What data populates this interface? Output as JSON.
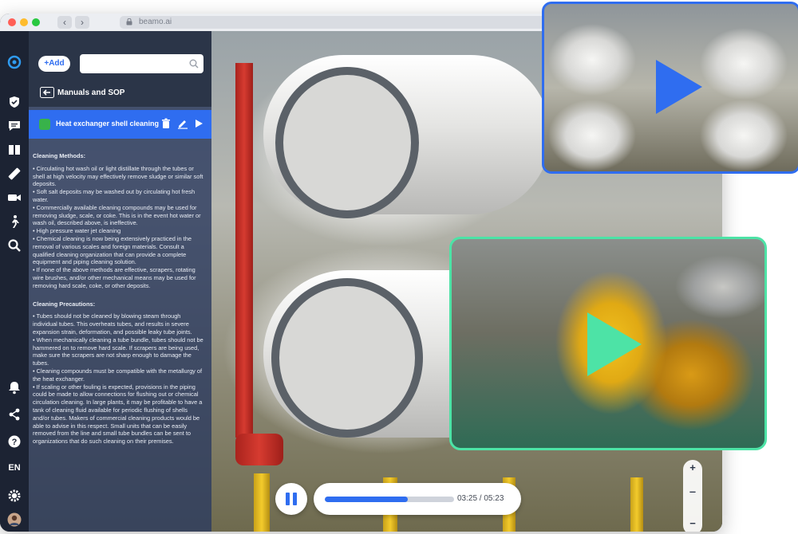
{
  "window": {
    "url": "beamo.ai",
    "traffic_lights": [
      "#ff5f57",
      "#febc2e",
      "#28c840"
    ]
  },
  "rail": {
    "items": [
      {
        "name": "logo-icon"
      },
      {
        "name": "shield-check-icon"
      },
      {
        "name": "chat-icon"
      },
      {
        "name": "manual-book-icon"
      },
      {
        "name": "ruler-icon"
      },
      {
        "name": "video-camera-icon"
      },
      {
        "name": "walking-person-icon"
      },
      {
        "name": "search-icon"
      },
      {
        "name": "bell-icon"
      },
      {
        "name": "share-icon"
      },
      {
        "name": "help-icon"
      },
      {
        "name": "settings-gear-icon"
      },
      {
        "name": "user-avatar"
      }
    ],
    "language": "EN"
  },
  "panel": {
    "add_label": "+Add",
    "search_placeholder": "",
    "back_label": "Manuals and SOP",
    "active_item": "Heat exchanger shell cleaning",
    "sections": [
      {
        "heading": "Cleaning Methods:",
        "paragraphs": [
          "• Circulating hot wash oil or light distillate through the tubes or shell at high velocity may effectively remove sludge or similar soft deposits.",
          "• Soft salt deposits may be washed out by circulating hot fresh water.",
          "• Commercially available cleaning compounds may be used for removing sludge, scale, or coke. This is in the event hot water or wash oil, described above, is ineffective.",
          "• High pressure water jet cleaning",
          "• Chemical cleaning is now being extensively practiced in the removal of various scales and foreign materials. Consult a qualified cleaning organization that can provide a complete equipment and piping cleaning solution.",
          "• If none of the above methods are effective, scrapers, rotating wire brushes, and/or other mechanical means may be used for removing hard scale, coke, or other deposits."
        ]
      },
      {
        "heading": "Cleaning Precautions:",
        "paragraphs": [
          "• Tubes should not be cleaned by blowing steam through individual tubes. This overheats tubes, and results in severe expansion strain, deformation, and possible leaky tube joints.",
          "• When mechanically cleaning a tube bundle, tubes should not be hammered on to remove hard scale. If scrapers are being used, make sure the scrapers are not sharp enough to damage the tubes.",
          "• Cleaning compounds must be compatible with the metallurgy of the heat exchanger.",
          "• If scaling or other fouling is expected, provisions in the piping could be made to allow connections for flushing out or chemical circulation cleaning. In large plants, it may be profitable to have a tank of cleaning fluid available for periodic flushing of shells and/or tubes. Makers of commercial cleaning products would be able to advise in this respect. Small units that can be easily removed from the line and small tube bundles can be sent to organizations that do such cleaning on their premises."
        ]
      }
    ]
  },
  "player": {
    "time": "03:25 / 05:23",
    "progress": 0.643
  },
  "zoom": {
    "plus": "+",
    "minus": "−"
  },
  "colors": {
    "accent": "#2f6df0",
    "teal": "#4de3a6",
    "rail_bg": "#1c2333"
  }
}
